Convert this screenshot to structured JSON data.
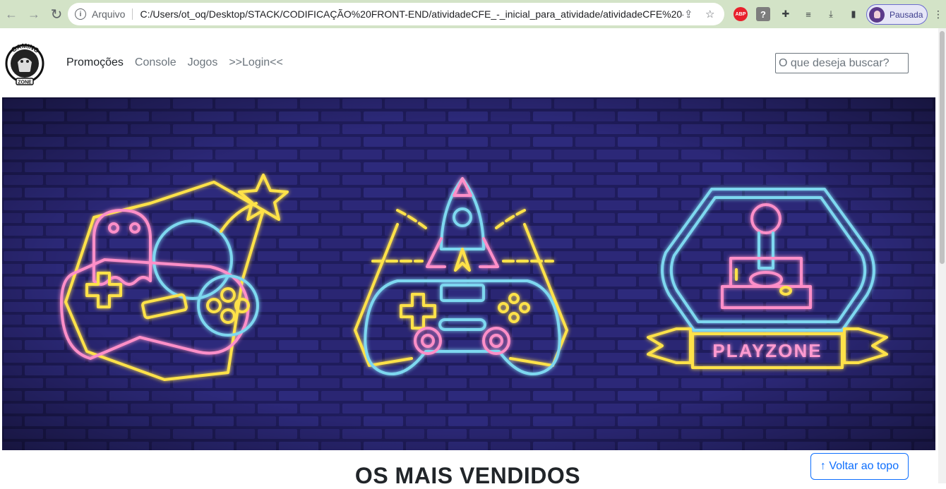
{
  "browser": {
    "scheme_label": "Arquivo",
    "url": "C:/Users/ot_oq/Desktop/STACK/CODIFICAÇÃO%20FRONT-END/atividadeCFE_-_inicial_para_atividade/atividadeCFE%20-%...",
    "profile_label": "Pausada",
    "extensions": [
      "abp-icon",
      "help-icon",
      "puzzle-icon",
      "media-icon",
      "download-icon",
      "sidepanel-icon"
    ],
    "abp_text": "ABP",
    "help_text": "?"
  },
  "site": {
    "logo_top": "GAMING",
    "logo_bottom": "ZONE",
    "nav": [
      {
        "label": "Promoções",
        "active": true
      },
      {
        "label": "Console",
        "active": false
      },
      {
        "label": "Jogos",
        "active": false
      },
      {
        "label": ">>Login<<",
        "active": false
      }
    ],
    "search_placeholder": "O que deseja buscar?"
  },
  "banner": {
    "sign_text": "PLAYZONE"
  },
  "main": {
    "section_title": "OS MAIS VENDIDOS",
    "back_to_top": "↑ Voltar ao topo"
  },
  "colors": {
    "brick_bg": "#1f1c5c",
    "neon_pink": "#ff8fc8",
    "neon_yellow": "#ffe24a",
    "neon_cyan": "#7ed8f0",
    "link_blue": "#0d6efd"
  }
}
